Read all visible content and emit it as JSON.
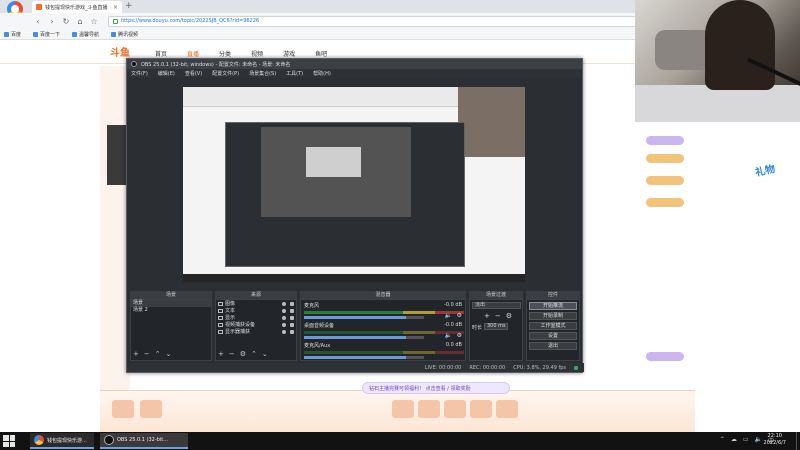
{
  "browser": {
    "logo_label": "世界杯直播",
    "tab_title": "钱包提现快乐游戏_斗鱼直播",
    "new_tab": "+",
    "nav": [
      "‹",
      "›",
      "↻",
      "⌂",
      "☆"
    ],
    "url": "https://www.douyu.com/topic/2022SJB_QC6?rid=96226",
    "bookmarks": [
      "百度",
      "百度一下",
      "温馨导航",
      "腾讯视频"
    ]
  },
  "douyu": {
    "logo": "斗鱼",
    "nav": [
      "首页",
      "直播",
      "分类",
      "视频",
      "游戏",
      "鱼吧"
    ],
    "banner": "钻石主播完赛可领福利！ 点击查看 / 领取奖励",
    "mascot": "礼物"
  },
  "obs": {
    "title": "OBS 25.0.1 (32-bit, windows) - 配置文件: 未命名 - 场景: 未命名",
    "menu": [
      "文件(F)",
      "编辑(E)",
      "查看(V)",
      "配置文件(P)",
      "场景集合(S)",
      "工具(T)",
      "帮助(H)"
    ],
    "panels": {
      "scenes": "场景",
      "sources": "来源",
      "mixer": "混音器",
      "transitions": "场景过渡",
      "controls": "控件"
    },
    "scenes": [
      "场景",
      "场景 2"
    ],
    "sources": [
      "图像",
      "文本",
      "显示",
      "视频捕获设备",
      "显示器捕获"
    ],
    "mixer": [
      {
        "name": "麦克风",
        "db": "-0.0 dB",
        "level": 0.85
      },
      {
        "name": "桌面音频设备",
        "db": "-0.0 dB",
        "level": 0.85
      },
      {
        "name": "麦克风/Aux",
        "db": "0.0 dB",
        "level": 0.85
      }
    ],
    "transitions": {
      "selected": "淡出",
      "add": "+",
      "remove": "−",
      "gear": "⚙",
      "duration_label": "时长",
      "duration": "300 ms"
    },
    "controls": [
      "开始推流",
      "开始录制",
      "工作室模式",
      "设置",
      "退出"
    ],
    "footer_icons": [
      "+",
      "−",
      "⌃",
      "⌄"
    ],
    "status": {
      "live": "LIVE: 00:00:00",
      "rec": "REC: 00:00:00",
      "cpu": "CPU: 3.8%, 29.49 fps"
    }
  },
  "taskbar": {
    "browser_item": "钱包提现快乐游...",
    "obs_item": "OBS 25.0.1 (32-bit...",
    "tray": [
      "⌃",
      "☁",
      "▭",
      "🔈",
      "中"
    ],
    "time": "22:10",
    "date": "2022/6/7"
  }
}
